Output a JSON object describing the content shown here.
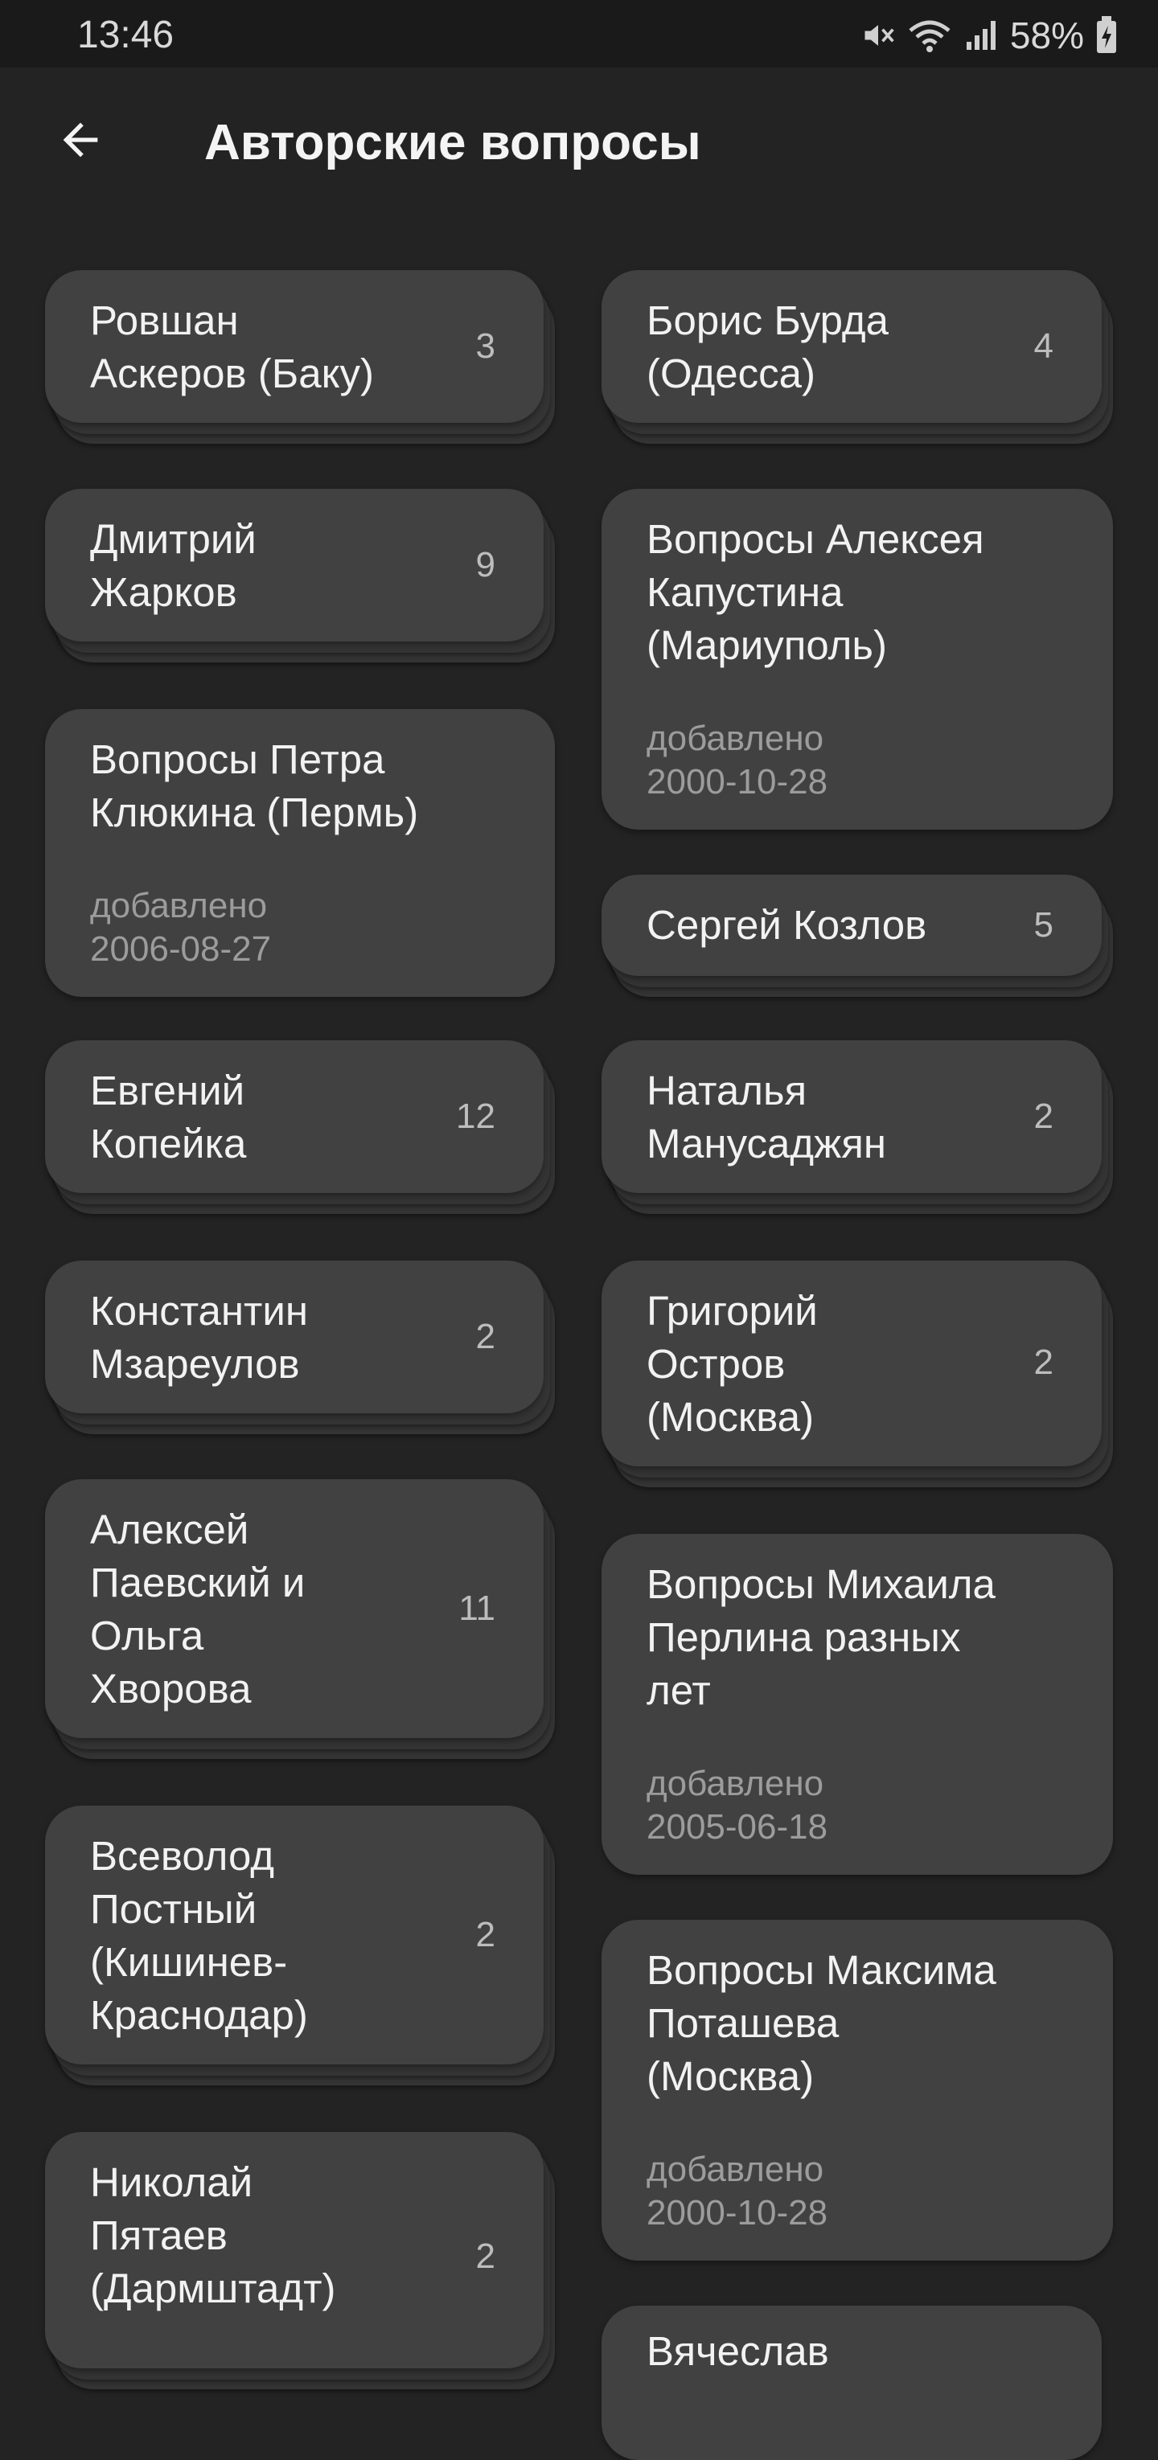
{
  "status_bar": {
    "time": "13:46",
    "battery": "58%",
    "icons": [
      "mute-icon",
      "wifi-icon",
      "signal-icon",
      "battery-charging-icon"
    ]
  },
  "header": {
    "title": "Авторские вопросы",
    "back_icon": "arrow-left-icon"
  },
  "colors": {
    "background": "#232323",
    "status_bar": "#1a1a1a",
    "card": "#414141",
    "card_stack": "#343434",
    "muted_text": "#9c9c9c"
  },
  "left_column": [
    {
      "title_lines": [
        "Ровшан",
        "Аскеров (Баку)"
      ],
      "count": "3"
    },
    {
      "title_lines": [
        "Дмитрий",
        "Жарков"
      ],
      "count": "9"
    },
    {
      "title_lines": [
        "Вопросы Петра",
        "Клюкина (Пермь)"
      ],
      "added_label": "добавлено",
      "added_date": "2006-08-27"
    },
    {
      "title_lines": [
        "Евгений",
        "Копейка"
      ],
      "count": "12"
    },
    {
      "title_lines": [
        "Константин",
        "Мзареулов"
      ],
      "count": "2"
    },
    {
      "title_lines": [
        "Алексей",
        "Паевский и",
        "Ольга",
        "Хворова"
      ],
      "count": "11"
    },
    {
      "title_lines": [
        "Всеволод",
        "Постный",
        "(Кишинев-",
        "Краснодар)"
      ],
      "count": "2"
    },
    {
      "title_lines": [
        "Николай",
        "Пятаев",
        "(Дармштадт)"
      ],
      "count": "2"
    }
  ],
  "right_column": [
    {
      "title_lines": [
        "Борис Бурда",
        "(Одесса)"
      ],
      "count": "4"
    },
    {
      "title_lines": [
        "Вопросы Алексея",
        "Капустина",
        "(Мариуполь)"
      ],
      "added_label": "добавлено",
      "added_date": "2000-10-28"
    },
    {
      "title_lines": [
        "Сергей Козлов"
      ],
      "count": "5"
    },
    {
      "title_lines": [
        "Наталья",
        "Манусаджян"
      ],
      "count": "2"
    },
    {
      "title_lines": [
        "Григорий",
        "Остров",
        "(Москва)"
      ],
      "count": "2"
    },
    {
      "title_lines": [
        "Вопросы Михаила",
        "Перлина разных",
        "лет"
      ],
      "added_label": "добавлено",
      "added_date": "2005-06-18"
    },
    {
      "title_lines": [
        "Вопросы Максима",
        "Поташева",
        "(Москва)"
      ],
      "added_label": "добавлено",
      "added_date": "2000-10-28"
    },
    {
      "title_lines": [
        "Вячеслав"
      ]
    }
  ]
}
